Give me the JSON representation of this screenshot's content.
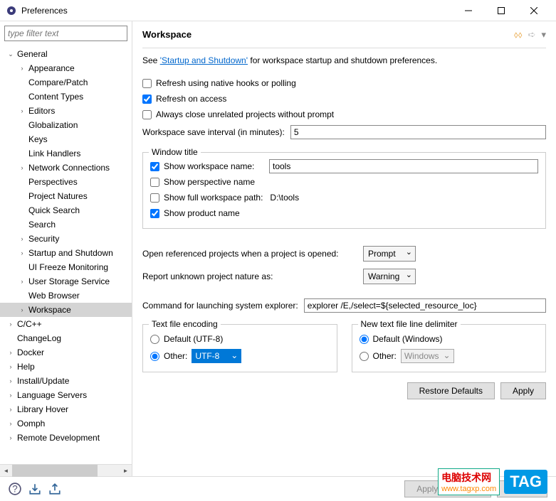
{
  "window": {
    "title": "Preferences"
  },
  "filter": {
    "placeholder": "type filter text"
  },
  "tree": {
    "items": [
      {
        "label": "General",
        "depth": 0,
        "arrow": "v",
        "selected": false
      },
      {
        "label": "Appearance",
        "depth": 1,
        "arrow": ">",
        "selected": false
      },
      {
        "label": "Compare/Patch",
        "depth": 1,
        "arrow": "",
        "selected": false
      },
      {
        "label": "Content Types",
        "depth": 1,
        "arrow": "",
        "selected": false
      },
      {
        "label": "Editors",
        "depth": 1,
        "arrow": ">",
        "selected": false
      },
      {
        "label": "Globalization",
        "depth": 1,
        "arrow": "",
        "selected": false
      },
      {
        "label": "Keys",
        "depth": 1,
        "arrow": "",
        "selected": false
      },
      {
        "label": "Link Handlers",
        "depth": 1,
        "arrow": "",
        "selected": false
      },
      {
        "label": "Network Connections",
        "depth": 1,
        "arrow": ">",
        "selected": false
      },
      {
        "label": "Perspectives",
        "depth": 1,
        "arrow": "",
        "selected": false
      },
      {
        "label": "Project Natures",
        "depth": 1,
        "arrow": "",
        "selected": false
      },
      {
        "label": "Quick Search",
        "depth": 1,
        "arrow": "",
        "selected": false
      },
      {
        "label": "Search",
        "depth": 1,
        "arrow": "",
        "selected": false
      },
      {
        "label": "Security",
        "depth": 1,
        "arrow": ">",
        "selected": false
      },
      {
        "label": "Startup and Shutdown",
        "depth": 1,
        "arrow": ">",
        "selected": false
      },
      {
        "label": "UI Freeze Monitoring",
        "depth": 1,
        "arrow": "",
        "selected": false
      },
      {
        "label": "User Storage Service",
        "depth": 1,
        "arrow": ">",
        "selected": false
      },
      {
        "label": "Web Browser",
        "depth": 1,
        "arrow": "",
        "selected": false
      },
      {
        "label": "Workspace",
        "depth": 1,
        "arrow": ">",
        "selected": true
      },
      {
        "label": "C/C++",
        "depth": 0,
        "arrow": ">",
        "selected": false
      },
      {
        "label": "ChangeLog",
        "depth": 0,
        "arrow": "",
        "selected": false
      },
      {
        "label": "Docker",
        "depth": 0,
        "arrow": ">",
        "selected": false
      },
      {
        "label": "Help",
        "depth": 0,
        "arrow": ">",
        "selected": false
      },
      {
        "label": "Install/Update",
        "depth": 0,
        "arrow": ">",
        "selected": false
      },
      {
        "label": "Language Servers",
        "depth": 0,
        "arrow": ">",
        "selected": false
      },
      {
        "label": "Library Hover",
        "depth": 0,
        "arrow": ">",
        "selected": false
      },
      {
        "label": "Oomph",
        "depth": 0,
        "arrow": ">",
        "selected": false
      },
      {
        "label": "Remote Development",
        "depth": 0,
        "arrow": ">",
        "selected": false
      }
    ]
  },
  "page": {
    "title": "Workspace",
    "desc_prefix": "See ",
    "desc_link": "'Startup and Shutdown'",
    "desc_suffix": " for workspace startup and shutdown preferences.",
    "refresh_native": "Refresh using native hooks or polling",
    "refresh_access": "Refresh on access",
    "always_close": "Always close unrelated projects without prompt",
    "save_interval_label": "Workspace save interval (in minutes):",
    "save_interval_value": "5",
    "window_title": {
      "legend": "Window title",
      "show_ws_name": "Show workspace name:",
      "ws_name_value": "tools",
      "show_persp": "Show perspective name",
      "show_full_path": "Show full workspace path:",
      "full_path_value": "D:\\tools",
      "show_product": "Show product name"
    },
    "open_ref_label": "Open referenced projects when a project is opened:",
    "open_ref_value": "Prompt",
    "report_nature_label": "Report unknown project nature as:",
    "report_nature_value": "Warning",
    "explorer_label": "Command for launching system explorer:",
    "explorer_value": "explorer /E,/select=${selected_resource_loc}",
    "encoding": {
      "legend": "Text file encoding",
      "default_label": "Default (UTF-8)",
      "other_label": "Other:",
      "other_value": "UTF-8"
    },
    "delimiter": {
      "legend": "New text file line delimiter",
      "default_label": "Default (Windows)",
      "other_label": "Other:",
      "other_value": "Windows"
    },
    "restore_defaults": "Restore Defaults",
    "apply": "Apply"
  },
  "footer": {
    "apply_close": "Apply and Close",
    "cancel": "Cancel"
  },
  "watermark": {
    "cn": "电脑技术网",
    "url": "www.tagxp.com",
    "tag": "TAG"
  }
}
